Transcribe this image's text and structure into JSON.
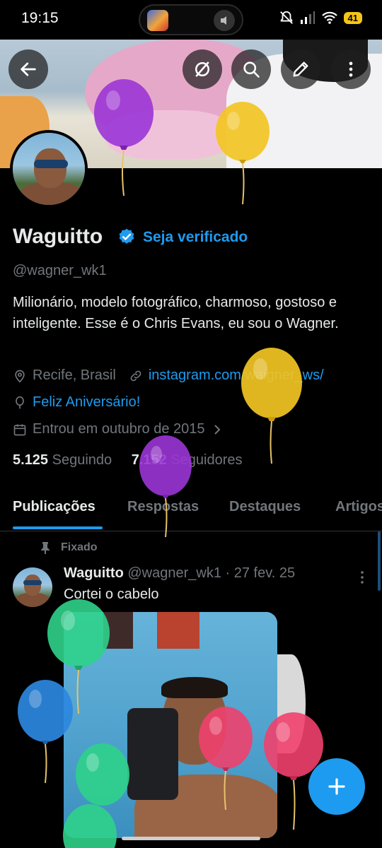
{
  "status_bar": {
    "time": "19:15",
    "battery": "41"
  },
  "header": {
    "back_icon": "arrow-left-icon",
    "grok_icon": "slash-circle-icon",
    "search_icon": "search-icon",
    "edit_icon": "pencil-icon",
    "more_icon": "vertical-dots-icon"
  },
  "profile": {
    "name": "Waguitto",
    "verify_cta": "Seja verificado",
    "handle": "@wagner_wk1",
    "bio": "Milionário, modelo fotográfico, charmoso, gostoso e inteligente. Esse é o Chris Evans, eu sou o Wagner.",
    "location": "Recife, Brasil",
    "website": "instagram.com/waigner_ws/",
    "birthday": "Feliz Aniversário!",
    "joined": "Entrou em outubro de 2015",
    "following_count": "5.125",
    "following_label": "Seguindo",
    "followers_count": "7.152",
    "followers_label": "Seguidores"
  },
  "tabs": [
    {
      "label": "Publicações",
      "active": true
    },
    {
      "label": "Respostas",
      "active": false
    },
    {
      "label": "Destaques",
      "active": false
    },
    {
      "label": "Artigos",
      "active": false
    }
  ],
  "pinned_post": {
    "pinned_label": "Fixado",
    "author_name": "Waguitto",
    "author_handle": "@wagner_wk1",
    "date": "· 27 fev. 25",
    "text": "Cortei o cabelo"
  },
  "colors": {
    "accent": "#1d9bf0",
    "background": "#000000",
    "text_primary": "#e7e9ea",
    "text_secondary": "#71767b"
  }
}
